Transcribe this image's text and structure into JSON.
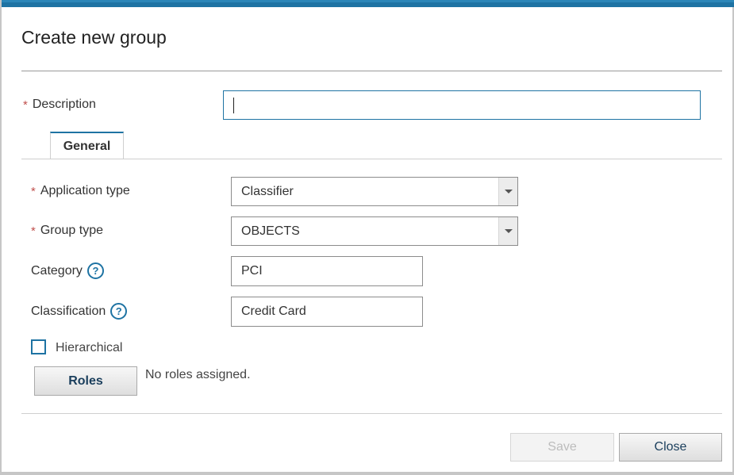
{
  "dialog": {
    "title": "Create new group",
    "description_label": "Description",
    "description_value": ""
  },
  "tabs": [
    {
      "label": "General",
      "active": true
    }
  ],
  "form": {
    "application_type": {
      "label": "Application type",
      "value": "Classifier"
    },
    "group_type": {
      "label": "Group type",
      "value": "OBJECTS"
    },
    "category": {
      "label": "Category",
      "value": "PCI"
    },
    "classification": {
      "label": "Classification",
      "value": "Credit Card"
    },
    "hierarchical": {
      "label": "Hierarchical",
      "checked": false
    },
    "roles": {
      "button_label": "Roles",
      "status": "No roles assigned."
    },
    "required_marker": "*",
    "help_glyph": "?"
  },
  "footer": {
    "save_label": "Save",
    "close_label": "Close"
  },
  "colors": {
    "accent": "#1e73a3",
    "required": "#c0504d"
  },
  "icons": [
    "chevron-down-icon",
    "help-icon"
  ]
}
